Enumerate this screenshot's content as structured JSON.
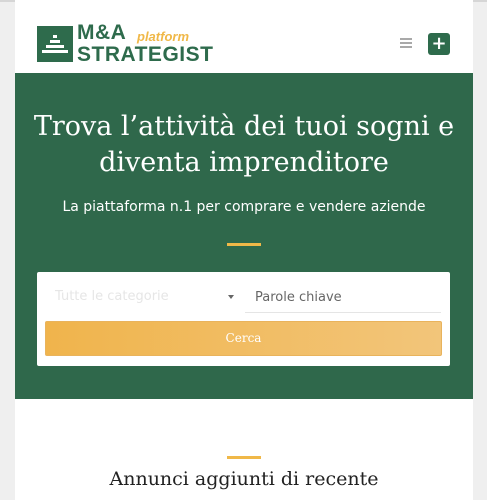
{
  "header": {
    "brand_line1": "M&A",
    "brand_line2": "STRATEGIST",
    "brand_tag": "platform",
    "icons": [
      "logo-steps-icon",
      "hamburger-menu-icon",
      "plus-icon"
    ],
    "plus_label": "+"
  },
  "hero": {
    "title_line1": "Trova l’attività dei tuoi sogni e",
    "title_line2": "diventa imprenditore",
    "subtitle": "La piattaforma n.1 per comprare e vendere aziende"
  },
  "search": {
    "category_selected": "Tutte le categorie",
    "keywords_placeholder": "Parole chiave",
    "button_label": "Cerca"
  },
  "section": {
    "title": "Annunci aggiunti di recente"
  },
  "colors": {
    "brand_green": "#2e6b4c",
    "accent_yellow": "#f0b848",
    "hero_bg": "#2f684b"
  }
}
